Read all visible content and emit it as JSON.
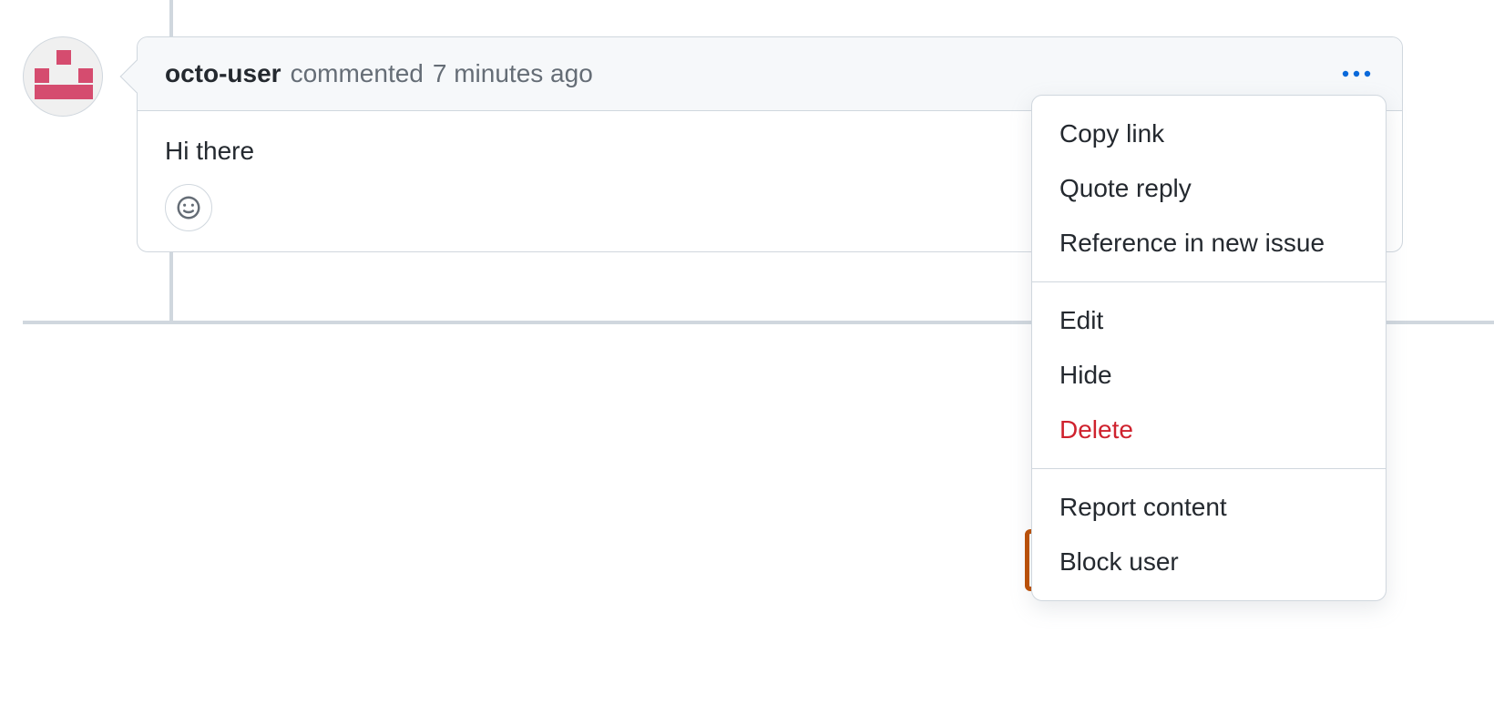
{
  "comment": {
    "author": "octo-user",
    "action_text": "commented",
    "timestamp": "7 minutes ago",
    "body": "Hi there"
  },
  "menu": {
    "groups": [
      {
        "items": [
          {
            "key": "copy-link",
            "label": "Copy link"
          },
          {
            "key": "quote-reply",
            "label": "Quote reply"
          },
          {
            "key": "reference-new-issue",
            "label": "Reference in new issue"
          }
        ]
      },
      {
        "items": [
          {
            "key": "edit",
            "label": "Edit"
          },
          {
            "key": "hide",
            "label": "Hide"
          },
          {
            "key": "delete",
            "label": "Delete",
            "danger": true
          }
        ]
      },
      {
        "items": [
          {
            "key": "report-content",
            "label": "Report content"
          },
          {
            "key": "block-user",
            "label": "Block user",
            "highlighted": true
          }
        ]
      }
    ]
  }
}
